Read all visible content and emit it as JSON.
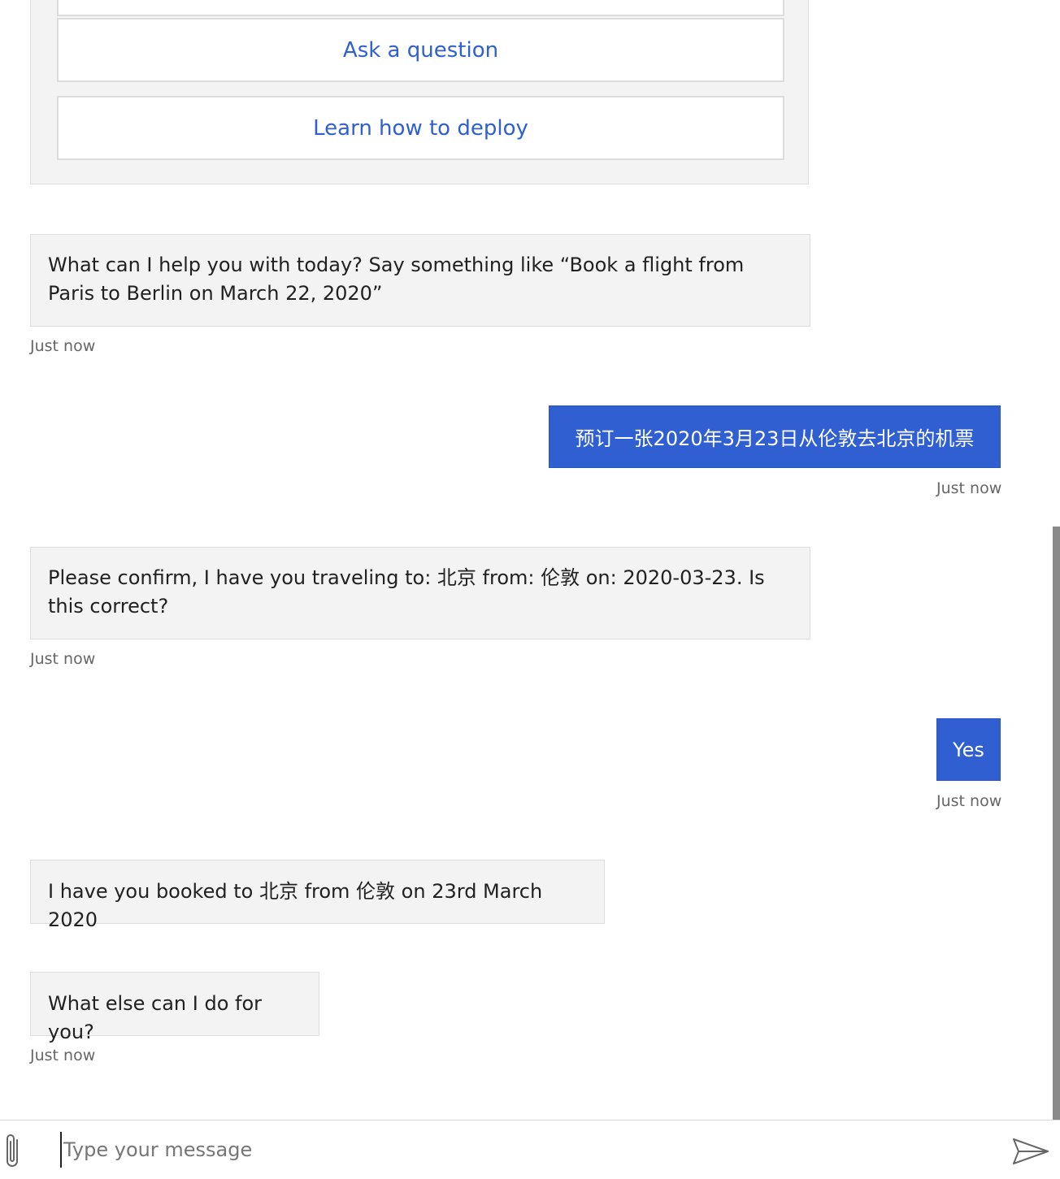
{
  "card": {
    "buttons": [
      "Ask a question",
      "Learn how to deploy"
    ]
  },
  "messages": {
    "bot_greeting": "What can I help you with today? Say something like “Book a flight from Paris to Berlin on March 22, 2020”",
    "bot_greeting_time": "Just now",
    "user_request": "预订一张2020年3月23日从伦敦去北京的机票",
    "user_request_time": "Just now",
    "bot_confirm": "Please confirm, I have you traveling to: 北京 from: 伦敦 on: 2020-03-23. Is this correct?",
    "bot_confirm_time": "Just now",
    "user_yes": "Yes",
    "user_yes_time": "Just now",
    "bot_booked": "I have you booked to 北京 from 伦敦 on 23rd March 2020",
    "bot_else": "What else can I do for you?",
    "bot_else_time": "Just now"
  },
  "sendbox": {
    "placeholder": "Type your message"
  },
  "colors": {
    "accent": "#2f5fd1",
    "bot_bubble": "#f3f3f3",
    "timestamp": "#666666"
  },
  "icons": {
    "attach": "paperclip-icon",
    "send": "send-icon"
  }
}
